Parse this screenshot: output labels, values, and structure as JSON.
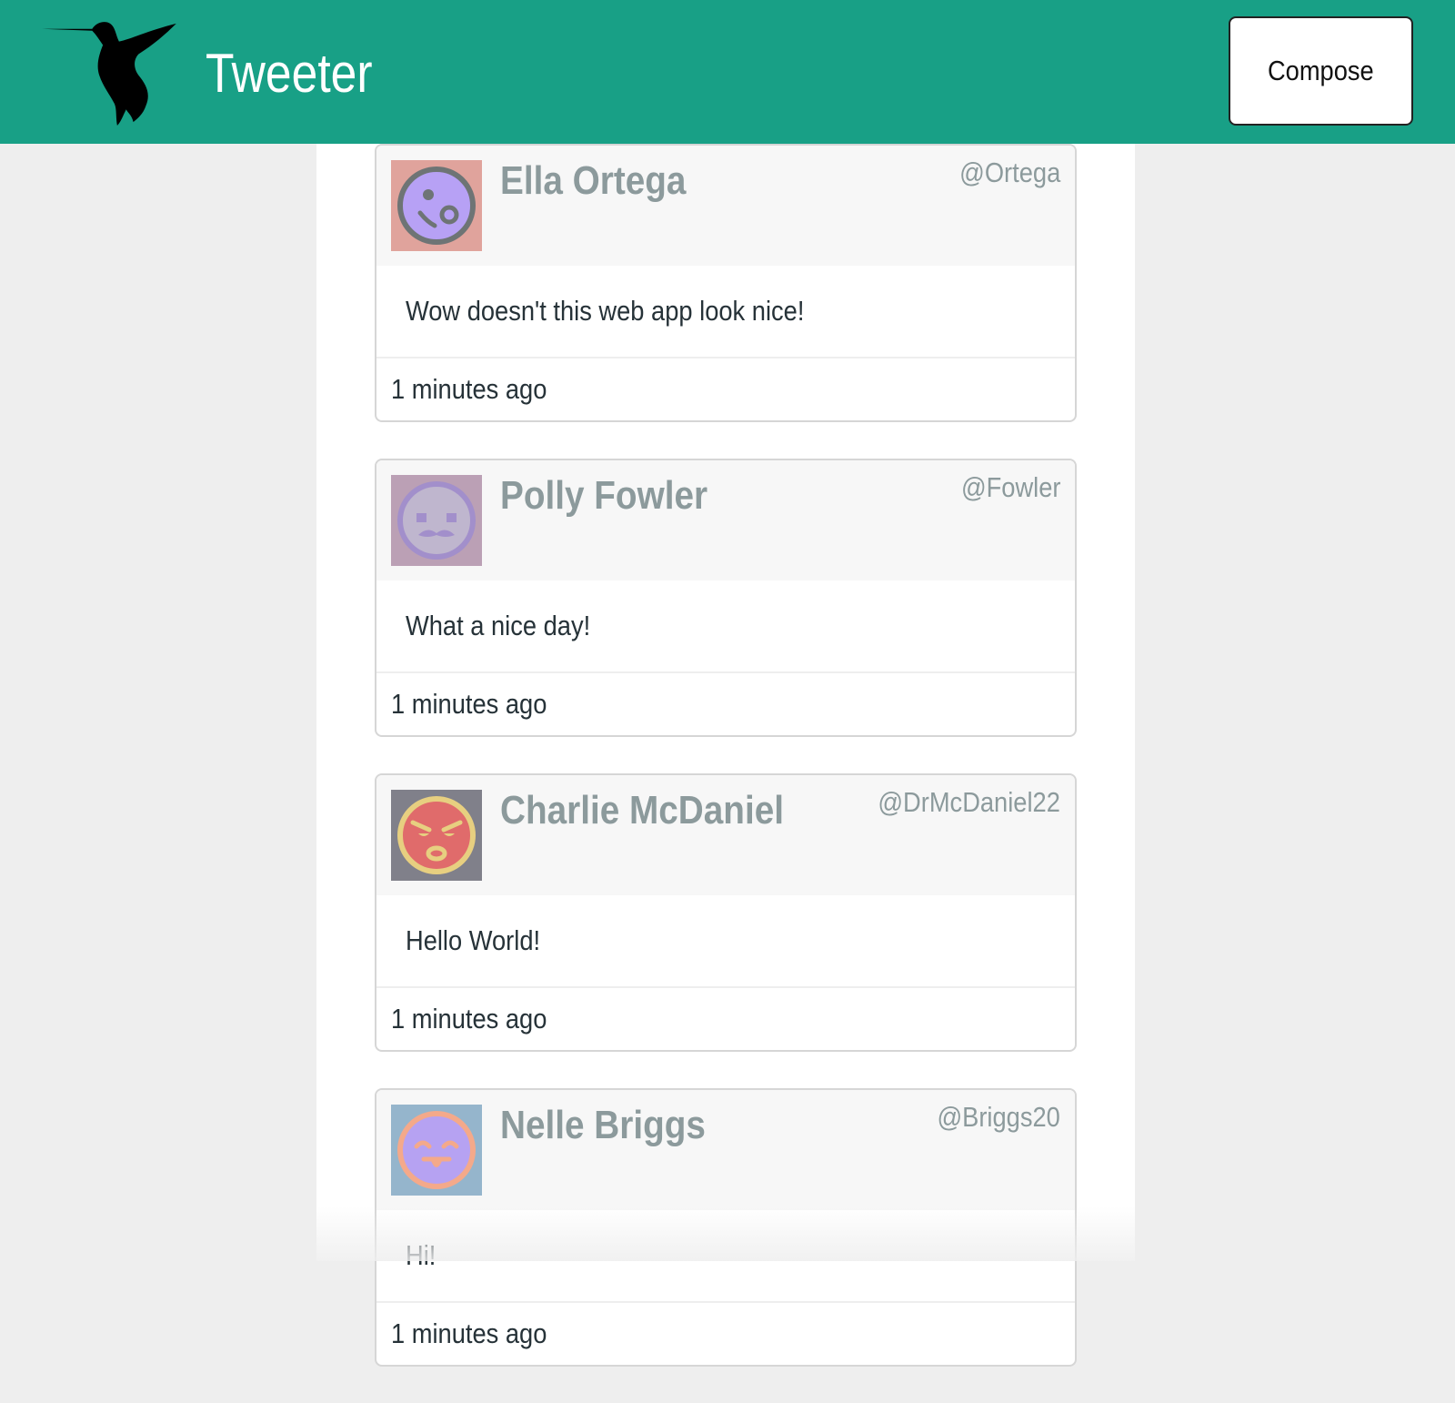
{
  "app": {
    "title": "Tweeter",
    "compose_label": "Compose",
    "logo_icon": "hummingbird-icon",
    "header_color": "#18a086"
  },
  "tweets": [
    {
      "name": "Ella Ortega",
      "handle": "@Ortega",
      "text": "Wow doesn't this web app look nice!",
      "time": "1 minutes ago",
      "avatar": {
        "icon": "avatar-wink-face-icon",
        "bg": "#e0a39c",
        "face": "#b7a1f5",
        "ring": "#6e7475"
      }
    },
    {
      "name": "Polly Fowler",
      "handle": "@Fowler",
      "text": "What a nice day!",
      "time": "1 minutes ago",
      "avatar": {
        "icon": "avatar-mustache-face-icon",
        "bg": "#bba0b5",
        "face": "#bfb6ce",
        "ring": "#a28fcb"
      }
    },
    {
      "name": "Charlie McDaniel",
      "handle": "@DrMcDaniel22",
      "text": "Hello World!",
      "time": "1 minutes ago",
      "avatar": {
        "icon": "avatar-angry-face-icon",
        "bg": "#80808a",
        "face": "#e06b6b",
        "ring": "#e7cf80"
      }
    },
    {
      "name": "Nelle Briggs",
      "handle": "@Briggs20",
      "text": "Hi!",
      "time": "1 minutes ago",
      "avatar": {
        "icon": "avatar-tongue-face-icon",
        "bg": "#95b5cc",
        "face": "#b6a2f2",
        "ring": "#f4a98a"
      }
    }
  ]
}
